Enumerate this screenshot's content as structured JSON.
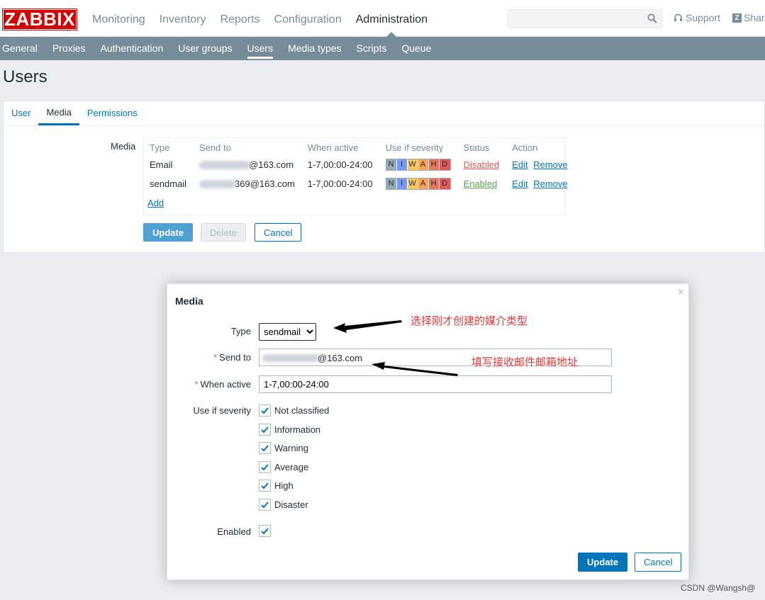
{
  "app": {
    "logo_text": "ZABBIX"
  },
  "main_nav": [
    {
      "label": "Monitoring"
    },
    {
      "label": "Inventory"
    },
    {
      "label": "Reports"
    },
    {
      "label": "Configuration"
    },
    {
      "label": "Administration"
    }
  ],
  "header": {
    "search_placeholder": "",
    "support_label": "Support",
    "share_label": "Share"
  },
  "sub_nav": [
    {
      "label": "General"
    },
    {
      "label": "Proxies"
    },
    {
      "label": "Authentication"
    },
    {
      "label": "User groups"
    },
    {
      "label": "Users"
    },
    {
      "label": "Media types"
    },
    {
      "label": "Scripts"
    },
    {
      "label": "Queue"
    }
  ],
  "page": {
    "title": "Users"
  },
  "tabs": [
    {
      "label": "User"
    },
    {
      "label": "Media"
    },
    {
      "label": "Permissions"
    }
  ],
  "media_section": {
    "label": "Media",
    "columns": [
      "Type",
      "Send to",
      "When active",
      "Use if severity",
      "Status",
      "Action"
    ],
    "rows": [
      {
        "type": "Email",
        "send_to": "@163.com",
        "when_active": "1-7,00:00-24:00",
        "status": "Disabled",
        "edit": "Edit",
        "remove": "Remove"
      },
      {
        "type": "sendmail",
        "send_to": "369@163.com",
        "when_active": "1-7,00:00-24:00",
        "status": "Enabled",
        "edit": "Edit",
        "remove": "Remove"
      }
    ],
    "severity_letters": [
      "N",
      "I",
      "W",
      "A",
      "H",
      "D"
    ],
    "add_label": "Add"
  },
  "form_buttons": {
    "update": "Update",
    "delete": "Delete",
    "cancel": "Cancel"
  },
  "dialog": {
    "title": "Media",
    "close_glyph": "×",
    "type_label": "Type",
    "type_selected": "sendmail",
    "send_to_label": "Send to",
    "send_to_value_visible": "@163.com",
    "when_active_label": "When active",
    "when_active_value": "1-7,00:00-24:00",
    "severity_label": "Use if severity",
    "severities": [
      {
        "label": "Not classified",
        "checked": true
      },
      {
        "label": "Information",
        "checked": true
      },
      {
        "label": "Warning",
        "checked": true
      },
      {
        "label": "Average",
        "checked": true
      },
      {
        "label": "High",
        "checked": true
      },
      {
        "label": "Disaster",
        "checked": true
      }
    ],
    "enabled_label": "Enabled",
    "enabled_checked": true,
    "update_label": "Update",
    "cancel_label": "Cancel"
  },
  "annotations": {
    "type_note": "选择刚才创建的媒介类型",
    "send_to_note": "填写接收邮件邮箱地址",
    "arrow_color": "#000000",
    "note_color": "#e53935"
  },
  "watermark": "CSDN @Wangsh@",
  "colors": {
    "brand": "#d40000",
    "subnav_bg": "#768d99",
    "link": "#0275b8",
    "disabled_status": "#e45959",
    "enabled_status": "#59a14f"
  }
}
